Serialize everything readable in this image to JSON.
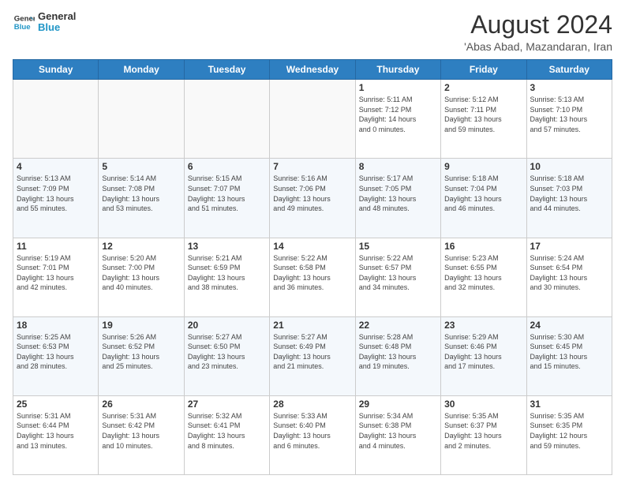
{
  "header": {
    "logo_line1": "General",
    "logo_line2": "Blue",
    "month_year": "August 2024",
    "location": "'Abas Abad, Mazandaran, Iran"
  },
  "weekdays": [
    "Sunday",
    "Monday",
    "Tuesday",
    "Wednesday",
    "Thursday",
    "Friday",
    "Saturday"
  ],
  "weeks": [
    [
      {
        "day": "",
        "info": ""
      },
      {
        "day": "",
        "info": ""
      },
      {
        "day": "",
        "info": ""
      },
      {
        "day": "",
        "info": ""
      },
      {
        "day": "1",
        "info": "Sunrise: 5:11 AM\nSunset: 7:12 PM\nDaylight: 14 hours\nand 0 minutes."
      },
      {
        "day": "2",
        "info": "Sunrise: 5:12 AM\nSunset: 7:11 PM\nDaylight: 13 hours\nand 59 minutes."
      },
      {
        "day": "3",
        "info": "Sunrise: 5:13 AM\nSunset: 7:10 PM\nDaylight: 13 hours\nand 57 minutes."
      }
    ],
    [
      {
        "day": "4",
        "info": "Sunrise: 5:13 AM\nSunset: 7:09 PM\nDaylight: 13 hours\nand 55 minutes."
      },
      {
        "day": "5",
        "info": "Sunrise: 5:14 AM\nSunset: 7:08 PM\nDaylight: 13 hours\nand 53 minutes."
      },
      {
        "day": "6",
        "info": "Sunrise: 5:15 AM\nSunset: 7:07 PM\nDaylight: 13 hours\nand 51 minutes."
      },
      {
        "day": "7",
        "info": "Sunrise: 5:16 AM\nSunset: 7:06 PM\nDaylight: 13 hours\nand 49 minutes."
      },
      {
        "day": "8",
        "info": "Sunrise: 5:17 AM\nSunset: 7:05 PM\nDaylight: 13 hours\nand 48 minutes."
      },
      {
        "day": "9",
        "info": "Sunrise: 5:18 AM\nSunset: 7:04 PM\nDaylight: 13 hours\nand 46 minutes."
      },
      {
        "day": "10",
        "info": "Sunrise: 5:18 AM\nSunset: 7:03 PM\nDaylight: 13 hours\nand 44 minutes."
      }
    ],
    [
      {
        "day": "11",
        "info": "Sunrise: 5:19 AM\nSunset: 7:01 PM\nDaylight: 13 hours\nand 42 minutes."
      },
      {
        "day": "12",
        "info": "Sunrise: 5:20 AM\nSunset: 7:00 PM\nDaylight: 13 hours\nand 40 minutes."
      },
      {
        "day": "13",
        "info": "Sunrise: 5:21 AM\nSunset: 6:59 PM\nDaylight: 13 hours\nand 38 minutes."
      },
      {
        "day": "14",
        "info": "Sunrise: 5:22 AM\nSunset: 6:58 PM\nDaylight: 13 hours\nand 36 minutes."
      },
      {
        "day": "15",
        "info": "Sunrise: 5:22 AM\nSunset: 6:57 PM\nDaylight: 13 hours\nand 34 minutes."
      },
      {
        "day": "16",
        "info": "Sunrise: 5:23 AM\nSunset: 6:55 PM\nDaylight: 13 hours\nand 32 minutes."
      },
      {
        "day": "17",
        "info": "Sunrise: 5:24 AM\nSunset: 6:54 PM\nDaylight: 13 hours\nand 30 minutes."
      }
    ],
    [
      {
        "day": "18",
        "info": "Sunrise: 5:25 AM\nSunset: 6:53 PM\nDaylight: 13 hours\nand 28 minutes."
      },
      {
        "day": "19",
        "info": "Sunrise: 5:26 AM\nSunset: 6:52 PM\nDaylight: 13 hours\nand 25 minutes."
      },
      {
        "day": "20",
        "info": "Sunrise: 5:27 AM\nSunset: 6:50 PM\nDaylight: 13 hours\nand 23 minutes."
      },
      {
        "day": "21",
        "info": "Sunrise: 5:27 AM\nSunset: 6:49 PM\nDaylight: 13 hours\nand 21 minutes."
      },
      {
        "day": "22",
        "info": "Sunrise: 5:28 AM\nSunset: 6:48 PM\nDaylight: 13 hours\nand 19 minutes."
      },
      {
        "day": "23",
        "info": "Sunrise: 5:29 AM\nSunset: 6:46 PM\nDaylight: 13 hours\nand 17 minutes."
      },
      {
        "day": "24",
        "info": "Sunrise: 5:30 AM\nSunset: 6:45 PM\nDaylight: 13 hours\nand 15 minutes."
      }
    ],
    [
      {
        "day": "25",
        "info": "Sunrise: 5:31 AM\nSunset: 6:44 PM\nDaylight: 13 hours\nand 13 minutes."
      },
      {
        "day": "26",
        "info": "Sunrise: 5:31 AM\nSunset: 6:42 PM\nDaylight: 13 hours\nand 10 minutes."
      },
      {
        "day": "27",
        "info": "Sunrise: 5:32 AM\nSunset: 6:41 PM\nDaylight: 13 hours\nand 8 minutes."
      },
      {
        "day": "28",
        "info": "Sunrise: 5:33 AM\nSunset: 6:40 PM\nDaylight: 13 hours\nand 6 minutes."
      },
      {
        "day": "29",
        "info": "Sunrise: 5:34 AM\nSunset: 6:38 PM\nDaylight: 13 hours\nand 4 minutes."
      },
      {
        "day": "30",
        "info": "Sunrise: 5:35 AM\nSunset: 6:37 PM\nDaylight: 13 hours\nand 2 minutes."
      },
      {
        "day": "31",
        "info": "Sunrise: 5:35 AM\nSunset: 6:35 PM\nDaylight: 12 hours\nand 59 minutes."
      }
    ]
  ],
  "colors": {
    "header_bg": "#2e7fc1",
    "accent": "#2196c7"
  }
}
